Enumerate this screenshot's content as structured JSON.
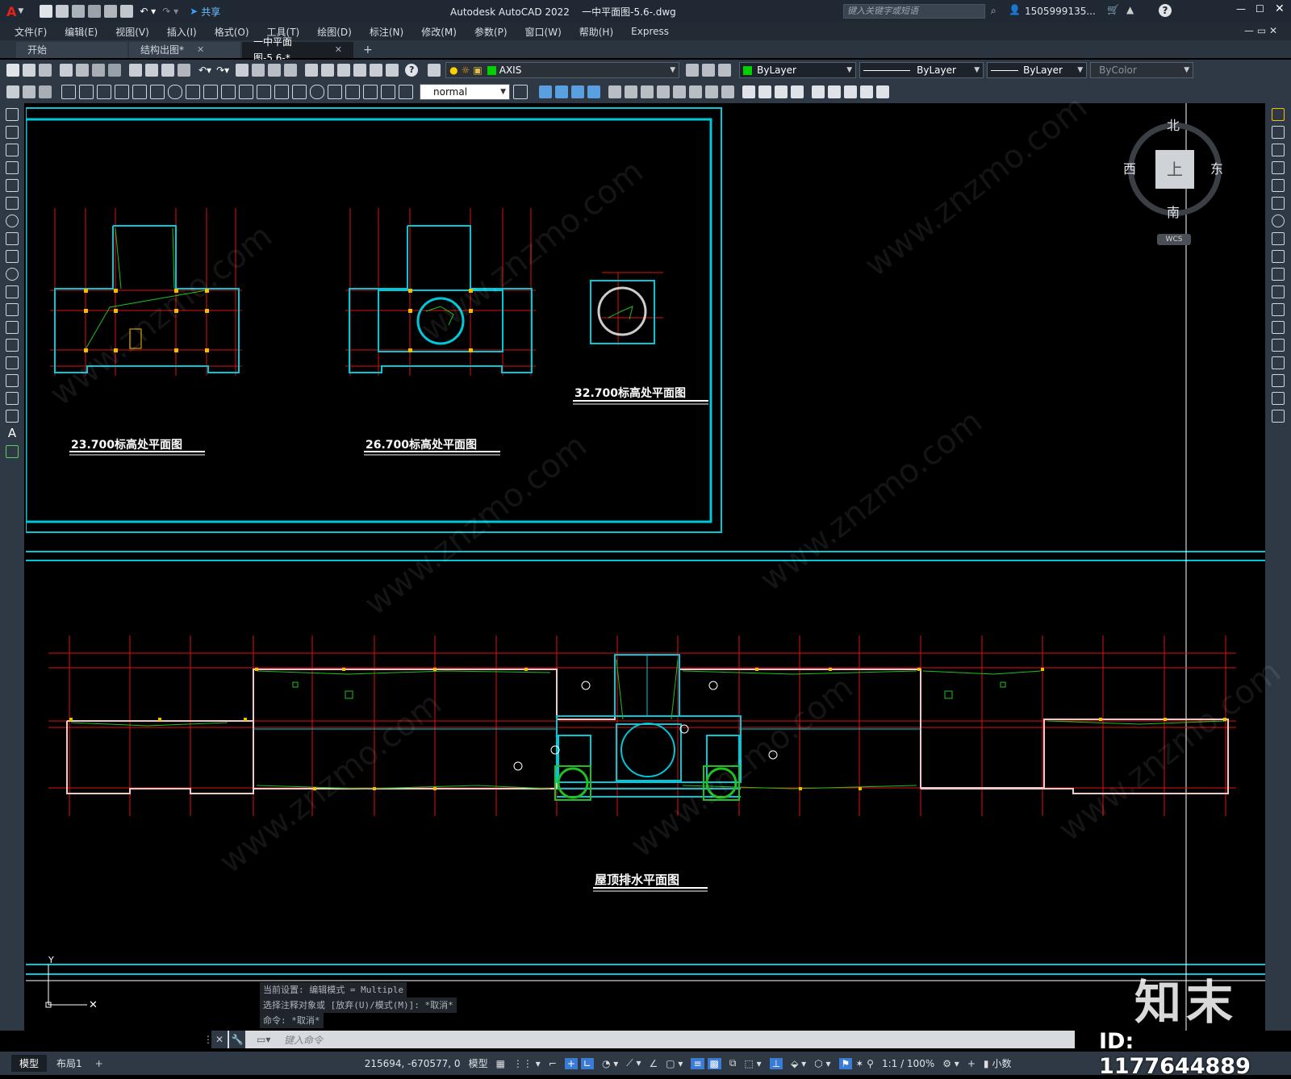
{
  "titlebar": {
    "app_logo": "A",
    "share_label": "共享",
    "title": "Autodesk AutoCAD 2022    一中平面图-5.6-.dwg",
    "search_placeholder": "键入关键字或短语",
    "user": "1505999135...",
    "help": "?"
  },
  "menu": [
    "文件(F)",
    "编辑(E)",
    "视图(V)",
    "插入(I)",
    "格式(O)",
    "工具(T)",
    "绘图(D)",
    "标注(N)",
    "修改(M)",
    "参数(P)",
    "窗口(W)",
    "帮助(H)",
    "Express"
  ],
  "tabs": [
    {
      "label": "开始",
      "closable": false
    },
    {
      "label": "结构出图*",
      "closable": true
    },
    {
      "label": "一中平面图-5.6-*",
      "closable": true,
      "active": true
    }
  ],
  "toolbar": {
    "layer_name": "AXIS",
    "color": "ByLayer",
    "linetype": "ByLayer",
    "lineweight": "ByLayer",
    "plotstyle": "ByColor",
    "textstyle": "normal"
  },
  "viewcube": {
    "north": "北",
    "south": "南",
    "east": "东",
    "west": "西",
    "top": "上",
    "wcs": "WCS"
  },
  "drawings": {
    "plan1": "23.700标高处平面图",
    "plan2": "26.700标高处平面图",
    "plan3": "32.700标高处平面图",
    "plan4": "屋顶排水平面图"
  },
  "command": {
    "history": [
      "当前设置: 编辑模式 = Multiple",
      "选择注释对象或 [放弃(U)/模式(M)]: *取消*",
      "命令: *取消*"
    ],
    "placeholder": "键入命令"
  },
  "status": {
    "coords": "215694, -670577, 0",
    "mode": "模型",
    "scale": "1:1 / 100%",
    "units": "小数",
    "model_tab": "模型",
    "layout_tab": "布局1"
  },
  "watermark": {
    "brand": "知末",
    "id": "ID: 1177644889",
    "site": "www.znzmo.com"
  },
  "colors": {
    "cyan": "#00c8d8",
    "red": "#e01010",
    "green": "#20c020",
    "yellow": "#f0c000",
    "titlebar": "#1f2833"
  }
}
